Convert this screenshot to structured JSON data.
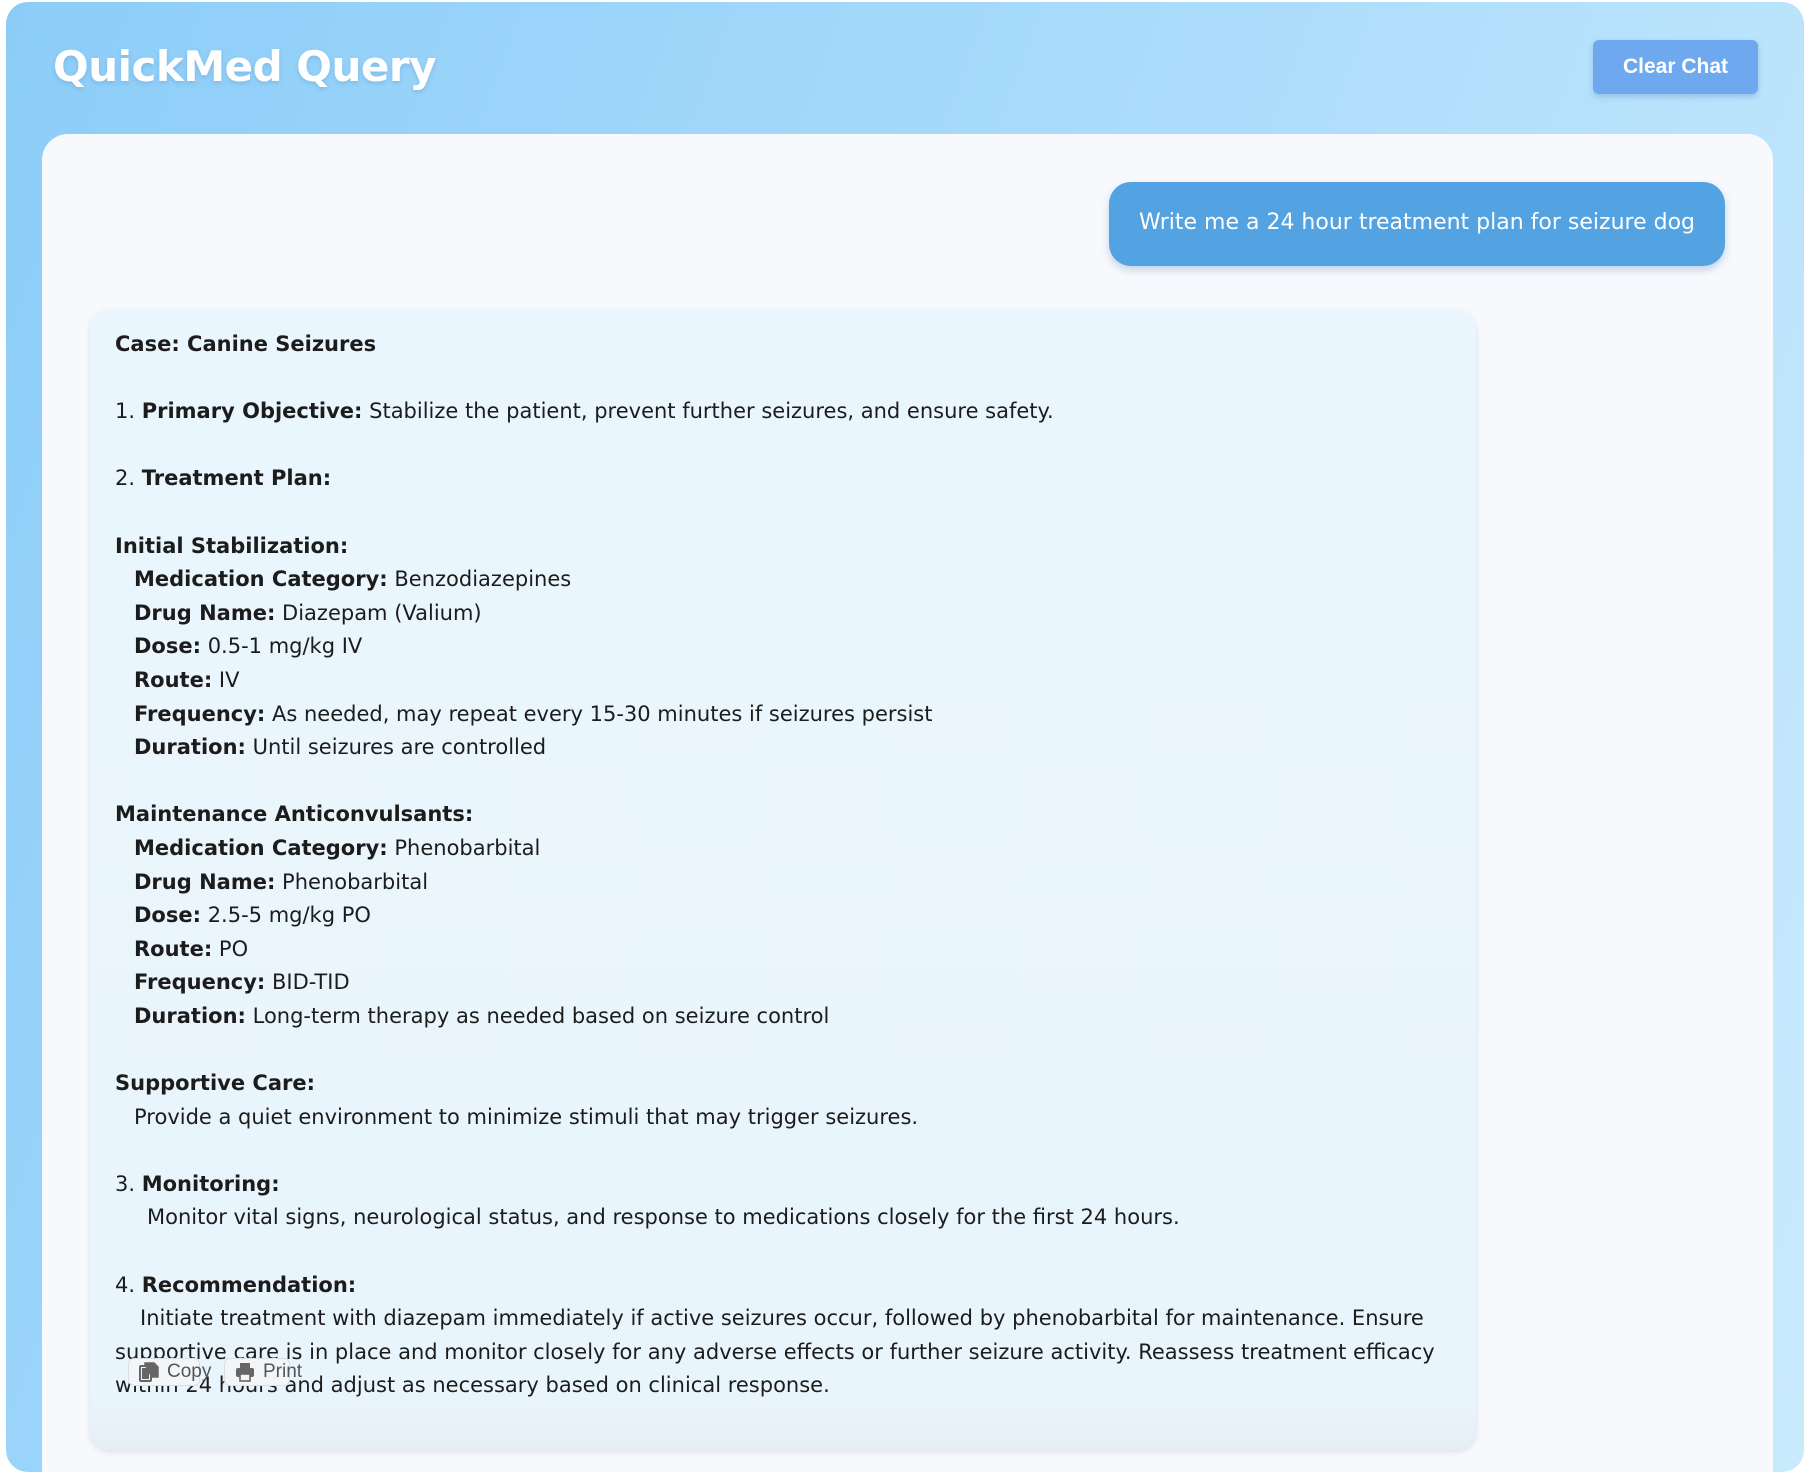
{
  "header": {
    "title": "QuickMed Query",
    "clear_label": "Clear Chat"
  },
  "user_message": "Write me a 24 hour treatment plan for seizure dog",
  "response": {
    "case_label": "Case: Canine Seizures",
    "s1_num": "1.",
    "s1_label": "Primary Objective:",
    "s1_text": "Stabilize the patient, prevent further seizures, and ensure safety.",
    "s2_num": "2.",
    "s2_label": "Treatment Plan:",
    "initial": {
      "heading": "Initial Stabilization:",
      "items": [
        {
          "label": "Medication Category:",
          "value": "Benzodiazepines"
        },
        {
          "label": "Drug Name:",
          "value": "Diazepam (Valium)"
        },
        {
          "label": "Dose:",
          "value": "0.5-1 mg/kg IV"
        },
        {
          "label": "Route:",
          "value": "IV"
        },
        {
          "label": "Frequency:",
          "value": "As needed, may repeat every 15-30 minutes if seizures persist"
        },
        {
          "label": "Duration:",
          "value": "Until seizures are controlled"
        }
      ]
    },
    "maintenance": {
      "heading": "Maintenance Anticonvulsants:",
      "items": [
        {
          "label": "Medication Category:",
          "value": "Phenobarbital"
        },
        {
          "label": "Drug Name:",
          "value": "Phenobarbital"
        },
        {
          "label": "Dose:",
          "value": "2.5-5 mg/kg PO"
        },
        {
          "label": "Route:",
          "value": "PO"
        },
        {
          "label": "Frequency:",
          "value": "BID-TID"
        },
        {
          "label": "Duration:",
          "value": "Long-term therapy as needed based on seizure control"
        }
      ]
    },
    "supportive": {
      "heading": "Supportive Care:",
      "text": "Provide a quiet environment to minimize stimuli that may trigger seizures."
    },
    "s3_num": "3.",
    "s3_label": "Monitoring:",
    "s3_text": "Monitor vital signs, neurological status, and response to medications closely for the first 24 hours.",
    "s4_num": "4.",
    "s4_label": "Recommendation:",
    "s4_text": "Initiate treatment with diazepam immediately if active seizures occur, followed by phenobarbital for maintenance. Ensure supportive care is in place and monitor closely for any adverse effects or further seizure activity. Reassess treatment efficacy within 24 hours and adjust as necessary based on clinical response."
  },
  "actions": {
    "copy_label": "Copy",
    "copy_icon": "copy-icon",
    "print_label": "Print",
    "print_icon": "printer-icon"
  }
}
